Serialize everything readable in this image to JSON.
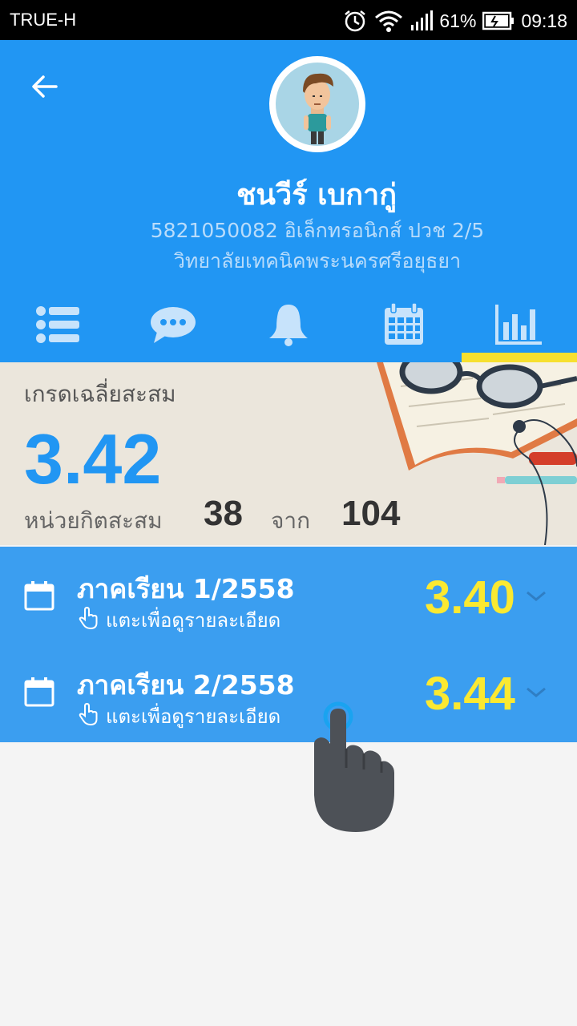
{
  "status_bar": {
    "carrier": "TRUE-H",
    "battery_percent": "61%",
    "time": "09:18"
  },
  "profile": {
    "name": "ชนวีร์ เบกากู่",
    "details": "5821050082 อิเล็กทรอนิกส์ ปวช 2/5",
    "college": "วิทยาลัยเทคนิคพระนครศรีอยุธยา"
  },
  "tabs": [
    {
      "icon": "list-icon"
    },
    {
      "icon": "chat-icon"
    },
    {
      "icon": "bell-icon"
    },
    {
      "icon": "calendar-icon"
    },
    {
      "icon": "bar-chart-icon",
      "active": true
    }
  ],
  "summary": {
    "gpa_label": "เกรดเฉลี่ยสะสม",
    "gpa_value": "3.42",
    "credits_label": "หน่วยกิตสะสม",
    "credits_earned": "38",
    "from_label": "จาก",
    "credits_total": "104"
  },
  "terms": [
    {
      "title": "ภาคเรียน 1/2558",
      "hint": "แตะเพื่อดูรายละเอียด",
      "gpa": "3.40"
    },
    {
      "title": "ภาคเรียน 2/2558",
      "hint": "แตะเพื่อดูรายละเอียด",
      "gpa": "3.44"
    }
  ],
  "colors": {
    "primary": "#2196f3",
    "term_bg": "#3b9ef0",
    "accent_yellow": "#fbe931",
    "indicator": "#f7e02f"
  }
}
